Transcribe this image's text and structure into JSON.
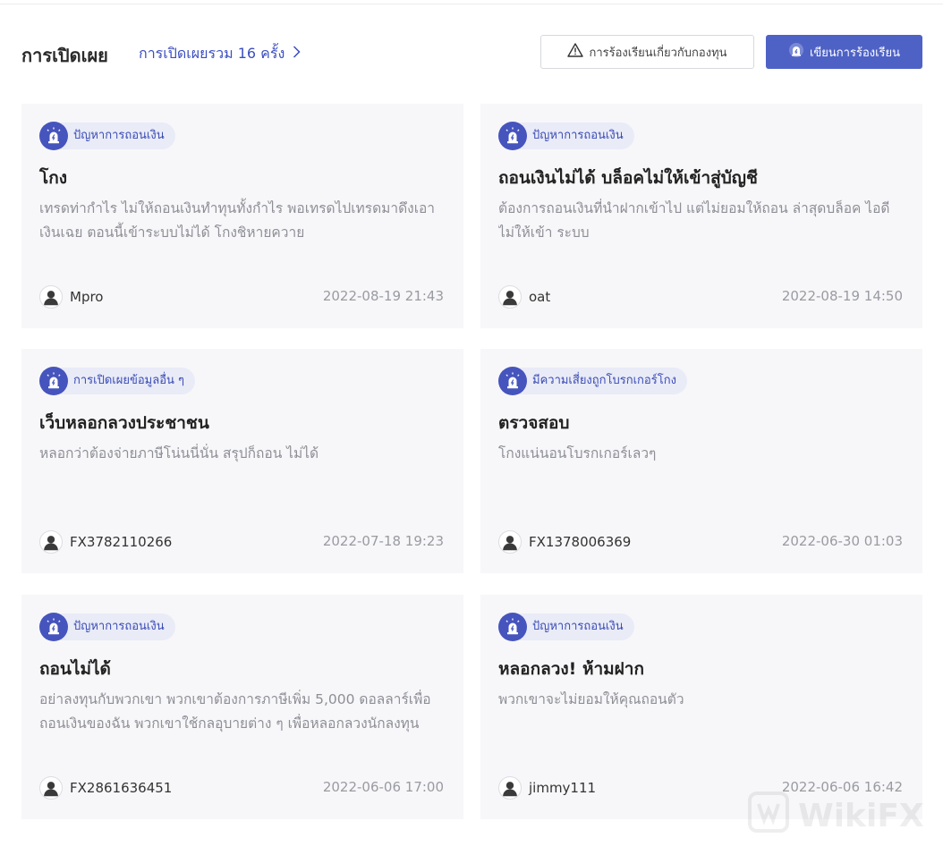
{
  "header": {
    "title": "การเปิดเผย",
    "total_link": "การเปิดเผยรวม 16 ครั้ง",
    "complaint_button": "การร้องเรียนเกี่ยวกับกองทุน",
    "write_button": "เขียนการร้องเรียน"
  },
  "colors": {
    "accent": "#4e62c6",
    "tag_bg": "#e9ebf7",
    "card_bg": "#f7f7f9"
  },
  "cards": [
    {
      "tag": "ปัญหาการถอนเงิน",
      "title": "โกง",
      "desc": "เทรดท่ากำไร ไม่ให้ถอนเงินทำทุนทั้งกำไร พอเทรดไปเทรดมาดึงเอาเงินเฉย ตอนนี้เข้าระบบไม่ได้ โกงชิหายควาย",
      "author": "Mpro",
      "date": "2022-08-19 21:43"
    },
    {
      "tag": "ปัญหาการถอนเงิน",
      "title": "ถอนเงินไม่ได้ บล็อคไม่ให้เข้าสู่บัญชี",
      "desc": "ต้องการถอนเงินที่นำฝากเข้าไป แต่ไม่ยอมให้ถอน ล่าสุดบล็อค ไอดีไม่ให้เข้า ระบบ",
      "author": "oat",
      "date": "2022-08-19 14:50"
    },
    {
      "tag": "การเปิดเผยข้อมูลอื่น ๆ",
      "title": "เว็บหลอกลวงประชาชน",
      "desc": "หลอกว่าต้องจ่ายภาษีโน่นนี่นั่น สรุปก็ถอน ไม่ได้",
      "author": "FX3782110266",
      "date": "2022-07-18 19:23"
    },
    {
      "tag": "มีความเสี่ยงถูกโบรกเกอร์โกง",
      "title": "ตรวจสอบ",
      "desc": "โกงแน่นอนโบรกเกอร์เลวๆ",
      "author": "FX1378006369",
      "date": "2022-06-30 01:03"
    },
    {
      "tag": "ปัญหาการถอนเงิน",
      "title": "ถอนไม่ได้",
      "desc": "อย่าลงทุนกับพวกเขา พวกเขาต้องการภาษีเพิ่ม 5,000 ดอลลาร์เพื่อถอนเงินของฉัน พวกเขาใช้กลอุบายต่าง ๆ เพื่อหลอกลวงนักลงทุน",
      "author": "FX2861636451",
      "date": "2022-06-06 17:00"
    },
    {
      "tag": "ปัญหาการถอนเงิน",
      "title": "หลอกลวง! ห้ามฝาก",
      "desc": "พวกเขาจะไม่ยอมให้คุณถอนตัว",
      "author": "jimmy111",
      "date": "2022-06-06 16:42"
    }
  ],
  "watermark": "WikiFX"
}
